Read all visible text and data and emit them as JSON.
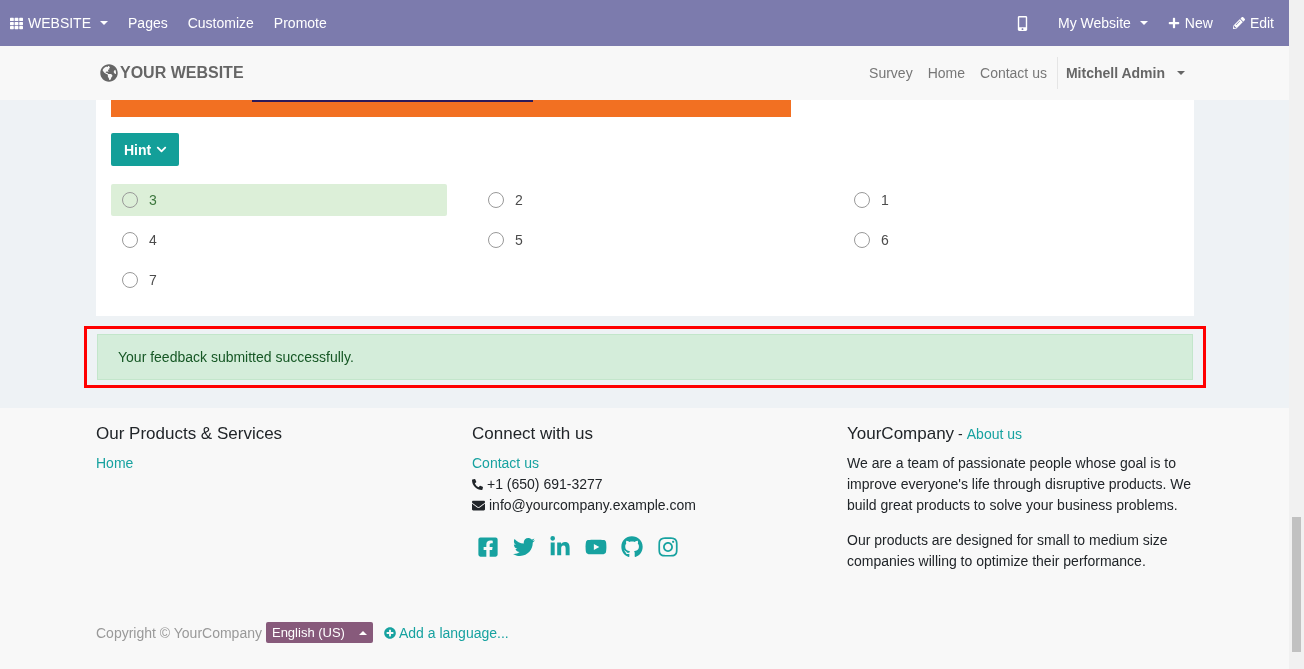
{
  "admin_bar": {
    "app_menu": "WEBSITE",
    "menus": [
      "Pages",
      "Customize",
      "Promote"
    ],
    "website_menu": "My Website",
    "new_button": "New",
    "edit_button": "Edit"
  },
  "header": {
    "logo": "YOUR WEBSITE",
    "nav": [
      "Survey",
      "Home",
      "Contact us"
    ],
    "user": "Mitchell Admin"
  },
  "question": {
    "hint_button": "Hint",
    "options": [
      {
        "label": "3",
        "checked": false,
        "highlighted": true
      },
      {
        "label": "2",
        "checked": false,
        "highlighted": false
      },
      {
        "label": "1",
        "checked": false,
        "highlighted": false
      },
      {
        "label": "4",
        "checked": false,
        "highlighted": false
      },
      {
        "label": "5",
        "checked": false,
        "highlighted": false
      },
      {
        "label": "6",
        "checked": false,
        "highlighted": false
      },
      {
        "label": "7",
        "checked": false,
        "highlighted": false
      }
    ]
  },
  "alert": {
    "message": "Your feedback submitted successfully.",
    "outlined": true
  },
  "footer": {
    "products": {
      "title": "Our Products & Services",
      "links": [
        "Home"
      ]
    },
    "connect": {
      "title": "Connect with us",
      "link": "Contact us",
      "phone": "+1 (650) 691-3277",
      "email": "info@yourcompany.example.com"
    },
    "company": {
      "title": "YourCompany",
      "separator": "-",
      "link": "About us",
      "paragraphs": [
        "We are a team of passionate people whose goal is to improve everyone's life through disruptive products. We build great products to solve your business problems.",
        "Our products are designed for small to medium size companies willing to optimize their performance."
      ]
    },
    "copyright": "Copyright © YourCompany",
    "language": "English (US)",
    "add_language": "Add a language..."
  }
}
